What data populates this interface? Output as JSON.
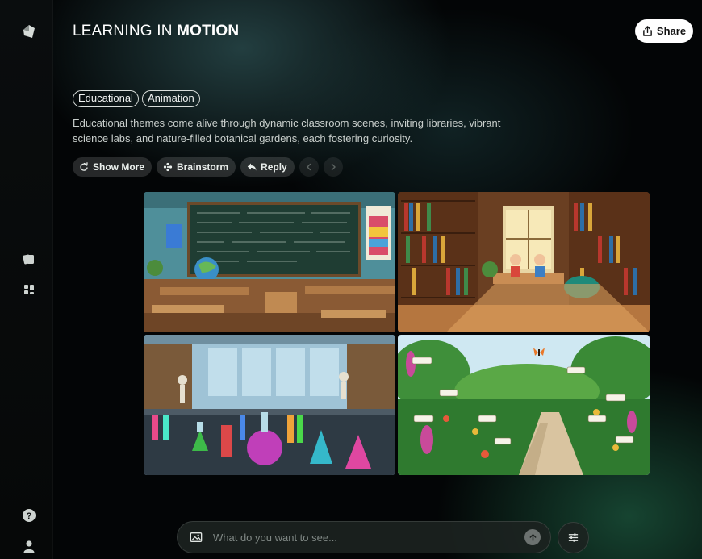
{
  "header": {
    "title_light": "LEARNING IN ",
    "title_bold": "MOTION",
    "share_label": "Share"
  },
  "tags": [
    "Educational",
    "Animation"
  ],
  "description": "Educational themes come alive through dynamic classroom scenes, inviting libraries, vibrant science labs, and nature-filled botanical gardens, each fostering curiosity.",
  "actions": {
    "show_more": "Show More",
    "brainstorm": "Brainstorm",
    "reply": "Reply"
  },
  "images": [
    {
      "scene": "classroom"
    },
    {
      "scene": "library"
    },
    {
      "scene": "science-lab"
    },
    {
      "scene": "botanical-garden"
    }
  ],
  "prompt": {
    "placeholder": "What do you want to see..."
  },
  "icons": {
    "logo": "logo-icon",
    "gallery": "cards-icon",
    "grid": "grid-icon",
    "help": "help-icon",
    "account": "user-icon"
  },
  "colors": {
    "background": "#030506",
    "accent_green": "#26784f",
    "share_bg": "#ffffff"
  }
}
